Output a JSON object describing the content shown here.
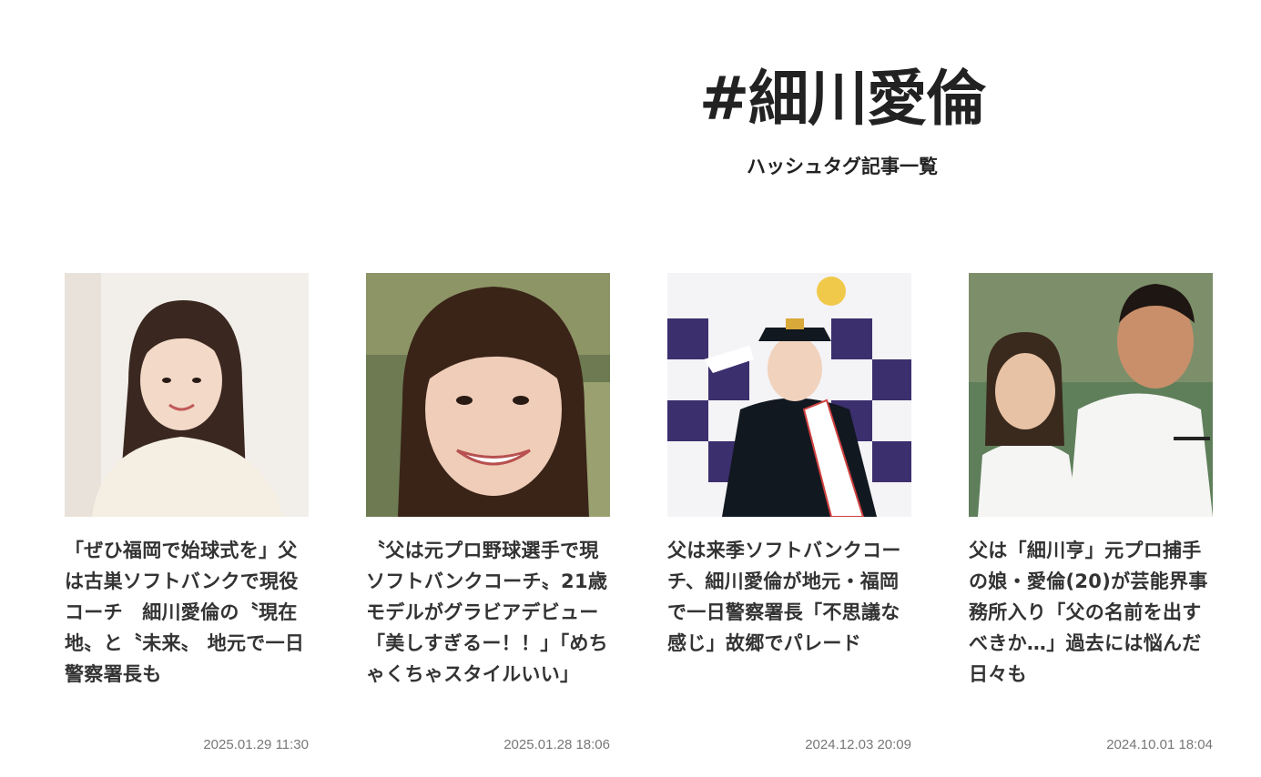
{
  "header": {
    "title": "#細川愛倫",
    "subtitle": "ハッシュタグ記事一覧"
  },
  "articles": [
    {
      "title": "「ぜひ福岡で始球式を」父は古巣ソフトバンクで現役コーチ　細川愛倫の〝現在地〟と〝未来〟 地元で一日警察署長も",
      "date": "2025.01.29 11:30",
      "thumb_colors": [
        "#f2efea",
        "#3a2820",
        "#f3d9c8",
        "#f4efe2"
      ]
    },
    {
      "title": "〝父は元プロ野球選手で現ソフトバンクコーチ〟21歳モデルがグラビアデビュー「美しすぎるー！！」「めちゃくちゃスタイルいい」",
      "date": "2025.01.28 18:06",
      "thumb_colors": [
        "#6d7a52",
        "#3a2418",
        "#efcdb8",
        "#9aa070"
      ]
    },
    {
      "title": "父は来季ソフトバンクコーチ、細川愛倫が地元・福岡で一日警察署長「不思議な感じ」故郷でパレード",
      "date": "2024.12.03 20:09",
      "thumb_colors": [
        "#f4f3f6",
        "#3c2f6e",
        "#f0d2bd",
        "#111820"
      ]
    },
    {
      "title": "父は「細川亨」元プロ捕手の娘・愛倫(20)が芸能界事務所入り「父の名前を出すべきか…」過去には悩んだ日々も",
      "date": "2024.10.01 18:04",
      "thumb_colors": [
        "#5f7f5a",
        "#3a2a1e",
        "#e7c2a4",
        "#f5f5f3"
      ]
    }
  ]
}
